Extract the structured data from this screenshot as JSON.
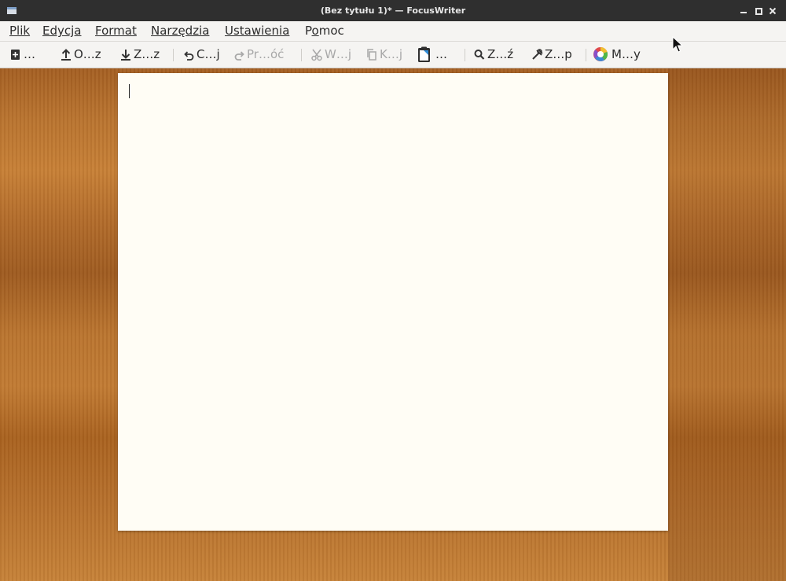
{
  "window": {
    "title": "(Bez tytułu 1)* — FocusWriter"
  },
  "menubar": {
    "items": [
      {
        "label": "Plik",
        "mnemonic": "P"
      },
      {
        "label": "Edycja",
        "mnemonic": "E"
      },
      {
        "label": "Format",
        "mnemonic": "F"
      },
      {
        "label": "Narzędzia",
        "mnemonic": "N"
      },
      {
        "label": "Ustawienia",
        "mnemonic": "U"
      },
      {
        "label": "Pomoc",
        "mnemonic": "o"
      }
    ]
  },
  "toolbar": {
    "new": {
      "label": "…",
      "icon": "new-document-icon"
    },
    "open": {
      "label": "O…z",
      "icon": "upload-icon"
    },
    "save": {
      "label": "Z…z",
      "icon": "download-icon"
    },
    "undo": {
      "label": "C…j",
      "icon": "undo-icon"
    },
    "redo": {
      "label": "Pr…óć",
      "icon": "redo-icon"
    },
    "cut": {
      "label": "W…j",
      "icon": "scissors-icon"
    },
    "copy": {
      "label": "K…j",
      "icon": "copy-icon"
    },
    "paste": {
      "label": "…",
      "icon": "clipboard-icon"
    },
    "find": {
      "label": "Z…ź",
      "icon": "search-icon"
    },
    "replace": {
      "label": "Z…p",
      "icon": "replace-icon"
    },
    "themes": {
      "label": "M…y",
      "icon": "color-wheel-icon"
    }
  },
  "colors": {
    "titlebar": "#2f2f2f",
    "toolbar": "#f5f4f2",
    "paper": "#fffdf5",
    "wood": "#b06a2a",
    "disabled_text": "#a8a8a8"
  }
}
